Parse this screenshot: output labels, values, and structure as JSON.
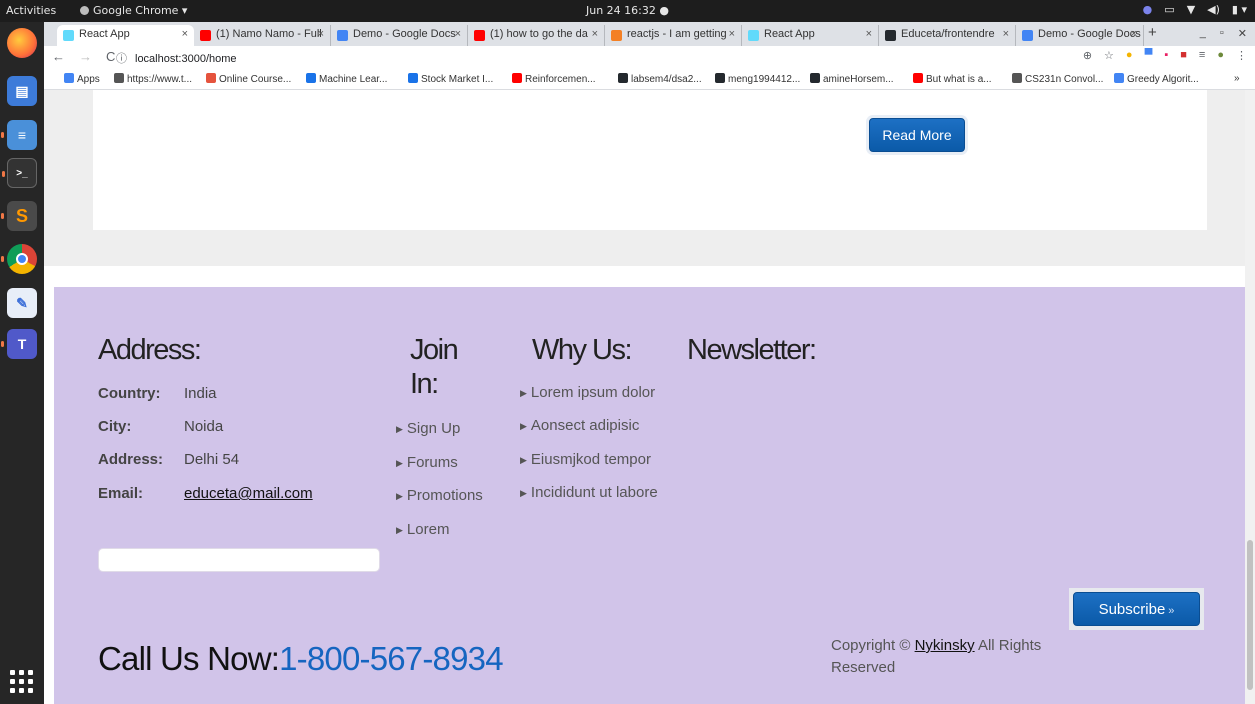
{
  "system": {
    "activities": "Activities",
    "app_name": "Google Chrome ▾",
    "clock": "Jun 24 16:32 ●"
  },
  "browser": {
    "tabs": [
      {
        "title": "React App",
        "active": true,
        "color": "#61dafb"
      },
      {
        "title": "(1) Namo Namo - Full",
        "color": "#ff0000"
      },
      {
        "title": "Demo - Google Docs",
        "color": "#4285f4"
      },
      {
        "title": "(1) how to go the da",
        "color": "#ff0000"
      },
      {
        "title": "reactjs - I am getting",
        "color": "#f48024"
      },
      {
        "title": "React App",
        "color": "#61dafb"
      },
      {
        "title": "Educeta/frontendre",
        "color": "#24292e"
      },
      {
        "title": "Demo - Google Docs",
        "color": "#4285f4"
      }
    ],
    "new_tab": "+",
    "url_info": "ⓘ",
    "url": "localhost:3000/home",
    "bookmarks": [
      {
        "label": "Apps",
        "color": "#4285f4"
      },
      {
        "label": "https://www.t...",
        "color": "#555555"
      },
      {
        "label": "Online Course...",
        "color": "#e5533d"
      },
      {
        "label": "Machine Lear...",
        "color": "#1a73e8"
      },
      {
        "label": "Stock Market I...",
        "color": "#1a73e8"
      },
      {
        "label": "Reinforcemen...",
        "color": "#ff0000"
      },
      {
        "label": "labsem4/dsa2...",
        "color": "#24292e"
      },
      {
        "label": "meng1994412...",
        "color": "#24292e"
      },
      {
        "label": "amineHorsem...",
        "color": "#24292e"
      },
      {
        "label": "But what is a...",
        "color": "#ff0000"
      },
      {
        "label": "CS231n Convol...",
        "color": "#555555"
      },
      {
        "label": "Greedy Algorit...",
        "color": "#4285f4"
      }
    ],
    "bookmarks_more": "»"
  },
  "page": {
    "read_more": "Read More",
    "footer": {
      "address_title": "Address:",
      "address_rows": [
        {
          "key": "Country:",
          "value": "India"
        },
        {
          "key": "City:",
          "value": "Noida"
        },
        {
          "key": "Address:",
          "value": "Delhi 54"
        },
        {
          "key": "Email:",
          "value": "educeta@mail.com"
        }
      ],
      "join_title_1": "Join",
      "join_title_2": "In:",
      "join_links": [
        "Sign Up",
        "Forums",
        "Promotions",
        "Lorem"
      ],
      "why_title": "Why Us:",
      "why_links": [
        "Lorem ipsum dolor",
        "Aonsect adipisic",
        "Eiusmjkod tempor",
        "Incididunt ut labore"
      ],
      "newsletter_title": "Newsletter:",
      "subscribe": "Subscribe",
      "subscribe_chevron": "»",
      "call_label": "Call Us Now:",
      "phone": "1-800-567-8934",
      "copyright_pre": "Copyright ©",
      "copyright_link": "Nykinsky",
      "copyright_post": "All Rights Reserved"
    }
  }
}
